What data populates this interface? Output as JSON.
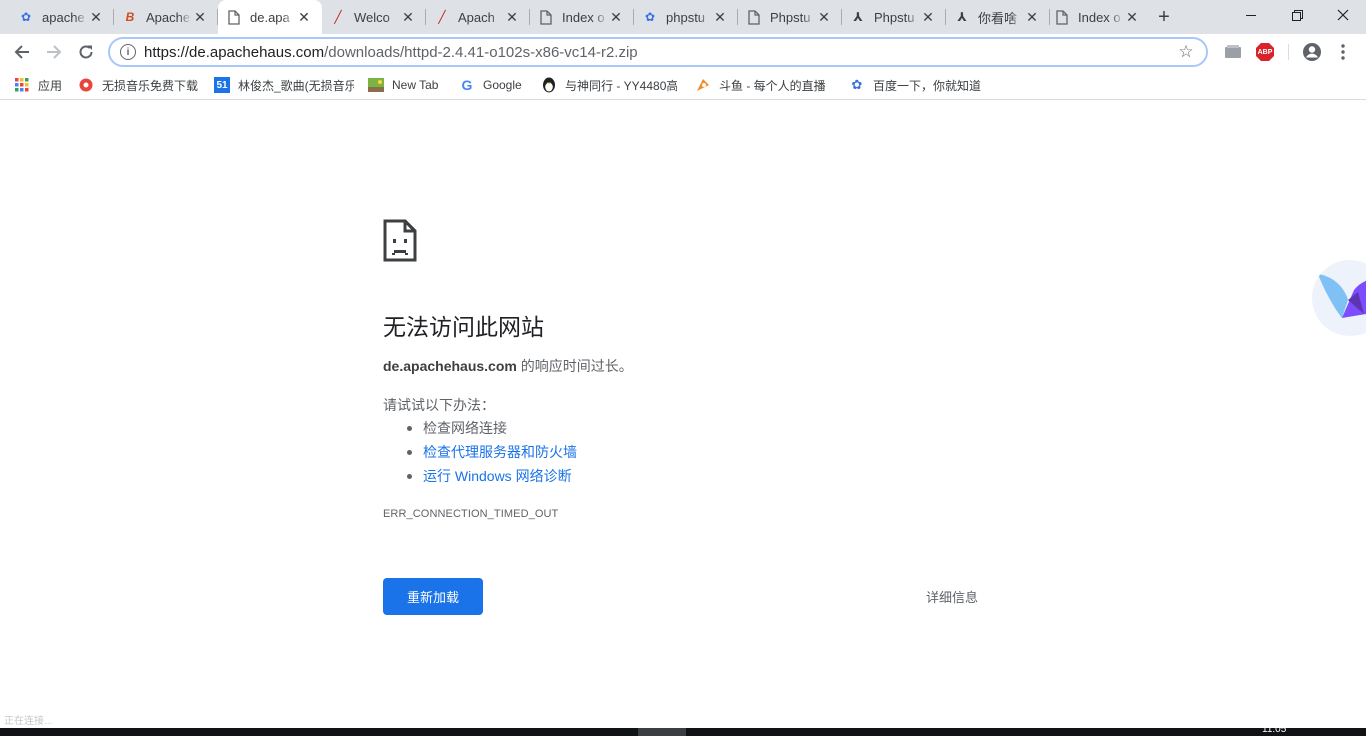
{
  "tabs": [
    {
      "title": "apache",
      "icon": "baidu-paw-icon",
      "icon_color": "#3a6fe0",
      "active": false
    },
    {
      "title": "Apache",
      "icon": "b-logo-icon",
      "icon_color": "#d24b1f",
      "active": false
    },
    {
      "title": "de.apa",
      "icon": "page-icon",
      "icon_color": "#5f6368",
      "active": true
    },
    {
      "title": "Welco",
      "icon": "feather-icon",
      "icon_color": "#c5221f",
      "active": false
    },
    {
      "title": "Apach",
      "icon": "feather-icon",
      "icon_color": "#c5221f",
      "active": false
    },
    {
      "title": "Index o",
      "icon": "page-icon",
      "icon_color": "#5f6368",
      "active": false
    },
    {
      "title": "phpstu",
      "icon": "baidu-paw-icon",
      "icon_color": "#3a6fe0",
      "active": false
    },
    {
      "title": "Phpstu",
      "icon": "page-icon",
      "icon_color": "#5f6368",
      "active": false
    },
    {
      "title": "Phpstu",
      "icon": "bird-logo-icon",
      "icon_color": "#3c4043",
      "active": false
    },
    {
      "title": "你看啥",
      "icon": "bird-logo-icon",
      "icon_color": "#3c4043",
      "active": false
    },
    {
      "title": "Index o",
      "icon": "page-icon",
      "icon_color": "#5f6368",
      "active": false
    }
  ],
  "toolbar": {
    "url_host": "https://de.apachehaus.com",
    "url_path": "/downloads/httpd-2.4.41-o102s-x86-vc14-r2.zip",
    "abp_label": "ABP"
  },
  "bookmarks": [
    {
      "label": "应用",
      "icon": "apps-grid-icon",
      "icon_color": "#e8453c"
    },
    {
      "label": "无损音乐免费下载",
      "icon": "music-icon",
      "icon_color": "#e8453c"
    },
    {
      "label": "林俊杰_歌曲(无损音乐",
      "icon": "site-51-icon",
      "icon_color": "#1a73e8"
    },
    {
      "label": "New Tab",
      "icon": "newtab-thumb-icon",
      "icon_color": "#4f8a3c"
    },
    {
      "label": "Google",
      "icon": "google-icon",
      "icon_color": "#4285f4"
    },
    {
      "label": "与神同行 - YY4480高",
      "icon": "penguin-icon",
      "icon_color": "#202124"
    },
    {
      "label": "斗鱼 - 每个人的直播",
      "icon": "douyu-icon",
      "icon_color": "#f28c28"
    },
    {
      "label": "百度一下，你就知道",
      "icon": "baidu-paw-icon",
      "icon_color": "#3a6fe0"
    }
  ],
  "error": {
    "title": "无法访问此网站",
    "host": "de.apachehaus.com",
    "host_suffix": " 的响应时间过长。",
    "try_heading": "请试试以下办法：",
    "suggestions": [
      "检查网络连接",
      "检查代理服务器和防火墙",
      "运行 Windows 网络诊断"
    ],
    "code": "ERR_CONNECTION_TIMED_OUT",
    "reload_label": "重新加载",
    "details_label": "详细信息"
  },
  "status_text": "正在连接...",
  "taskbar_clock": "11:05",
  "colors": {
    "accent": "#1a73e8",
    "tabstrip": "#dee1e6"
  }
}
